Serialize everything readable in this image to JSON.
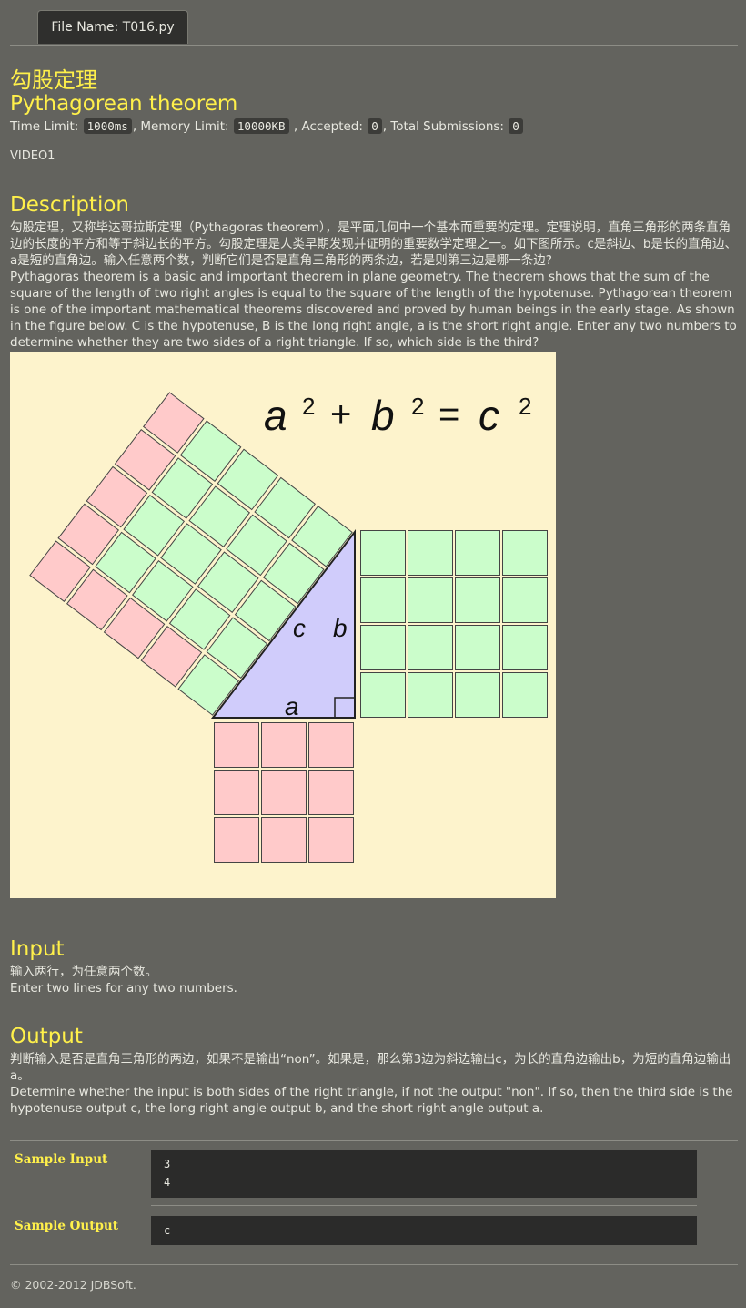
{
  "tab": {
    "file_label": "File Name:",
    "file_name": "T016.py"
  },
  "title": {
    "cn": "勾股定理",
    "en": "Pythagorean theorem"
  },
  "meta": {
    "time_limit_label": "Time Limit:",
    "time_limit_value": "1000ms",
    "memory_limit_label": ", Memory Limit:",
    "memory_limit_value": "10000KB",
    "accepted_label": ", Accepted:",
    "accepted_value": "0",
    "submissions_label": ", Total Submissions:",
    "submissions_value": "0"
  },
  "video_label": "VIDEO1",
  "description": {
    "heading": "Description",
    "cn": "勾股定理，又称毕达哥拉斯定理（Pythagoras theorem），是平面几何中一个基本而重要的定理。定理说明，直角三角形的两条直角边的长度的平方和等于斜边长的平方。勾股定理是人类早期发现并证明的重要数学定理之一。如下图所示。c是斜边、b是长的直角边、a是短的直角边。输入任意两个数，判断它们是否是直角三角形的两条边，若是则第三边是哪一条边?",
    "en": "Pythagoras theorem is a basic and important theorem in plane geometry. The theorem shows that the sum of the square of the length of two right angles is equal to the square of the length of the hypotenuse. Pythagorean theorem is one of the important mathematical theorems discovered and proved by human beings in the early stage. As shown in the figure below. C is the hypotenuse, B is the long right angle, a is the short right angle. Enter any two numbers to determine whether they are two sides of a right triangle. If so, which side is the third?"
  },
  "figure": {
    "equation": {
      "a": "a",
      "b": "b",
      "c": "c",
      "exp": "2",
      "plus": "+",
      "equals": "="
    },
    "labels": {
      "a": "a",
      "b": "b",
      "c": "c"
    },
    "colors": {
      "background": "#fdf3cc",
      "pink": "#ffcaca",
      "green": "#cbfdcb",
      "triangle": "#d0ccfb"
    }
  },
  "input": {
    "heading": "Input",
    "cn": "输入两行，为任意两个数。",
    "en": "Enter two lines for any two numbers."
  },
  "output": {
    "heading": "Output",
    "cn": "判断输入是否是直角三角形的两边，如果不是输出“non”。如果是，那么第3边为斜边输出c，为长的直角边输出b，为短的直角边输出a。",
    "en": "Determine whether the input is both sides of the right triangle, if not the output \"non\". If so, then the third side is the hypotenuse output c, the long right angle output b, and the short right angle output a."
  },
  "samples": {
    "input_label": "Sample Input",
    "input_lines": [
      "3",
      "4"
    ],
    "output_label": "Sample Output",
    "output_lines": [
      "c"
    ]
  },
  "footer": "© 2002-2012  JDBSoft."
}
